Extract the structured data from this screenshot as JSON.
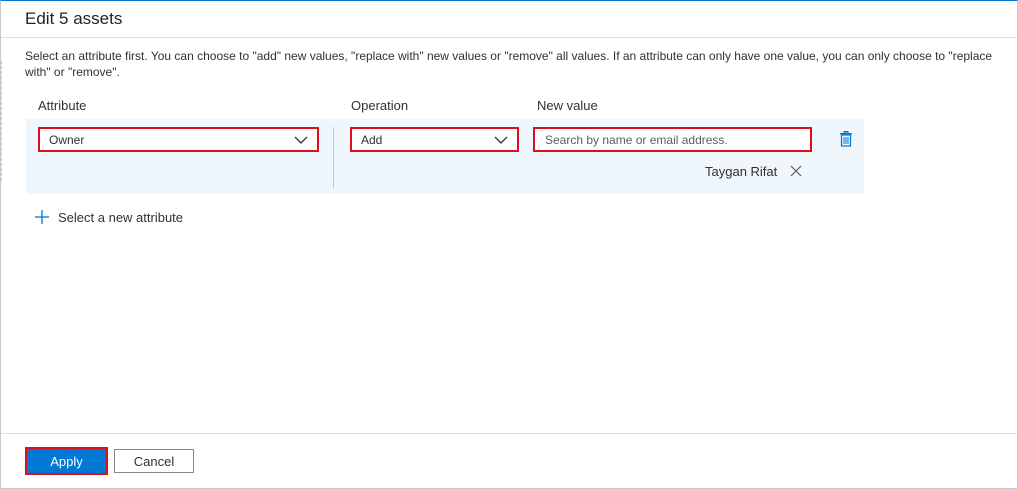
{
  "dialog": {
    "title": "Edit 5 assets",
    "description": "Select an attribute first. You can choose to \"add\" new values, \"replace with\" new values or \"remove\" all values. If an attribute can only have one value, you can only choose to \"replace with\" or \"remove\"."
  },
  "columns": {
    "attribute": "Attribute",
    "operation": "Operation",
    "new_value": "New value"
  },
  "row": {
    "attribute_selected": "Owner",
    "operation_selected": "Add",
    "search_placeholder": "Search by name or email address.",
    "search_value": "",
    "selected_values": [
      "Taygan Rifat"
    ],
    "delete_icon": "trash-icon",
    "remove_icon": "close-icon"
  },
  "add_attribute": {
    "icon": "plus-icon",
    "label": "Select a new attribute"
  },
  "footer": {
    "apply_label": "Apply",
    "cancel_label": "Cancel"
  },
  "colors": {
    "accent": "#0078d4",
    "row_background": "#eff6fc",
    "highlight_outline": "#e00b1c"
  }
}
